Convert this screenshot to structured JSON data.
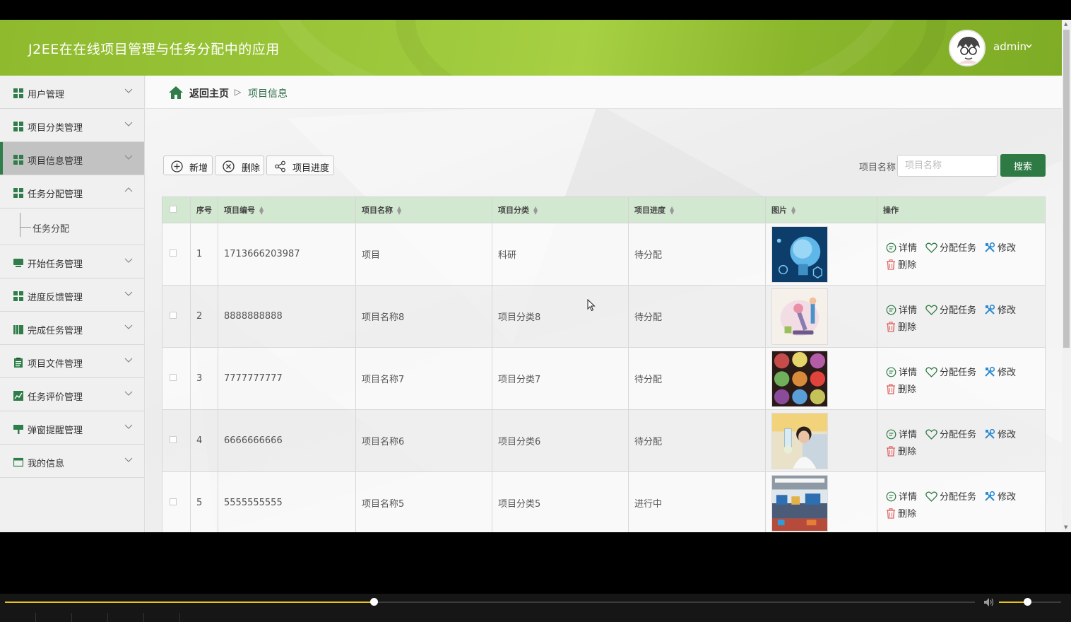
{
  "header": {
    "title": "J2EE在在线项目管理与任务分配中的应用",
    "user": "admin"
  },
  "sidebar": {
    "items": [
      {
        "label": "用户管理",
        "icon": "grid-icon",
        "expanded": false
      },
      {
        "label": "项目分类管理",
        "icon": "grid-icon",
        "expanded": false
      },
      {
        "label": "项目信息管理",
        "icon": "grid-icon",
        "expanded": false,
        "active": true
      },
      {
        "label": "任务分配管理",
        "icon": "grid-icon",
        "expanded": true
      },
      {
        "label": "开始任务管理",
        "icon": "monitor-icon",
        "expanded": false
      },
      {
        "label": "进度反馈管理",
        "icon": "grid-icon",
        "expanded": false
      },
      {
        "label": "完成任务管理",
        "icon": "books-icon",
        "expanded": false
      },
      {
        "label": "项目文件管理",
        "icon": "clipboard-icon",
        "expanded": false
      },
      {
        "label": "任务评价管理",
        "icon": "chart-icon",
        "expanded": false
      },
      {
        "label": "弹窗提醒管理",
        "icon": "sign-icon",
        "expanded": false
      },
      {
        "label": "我的信息",
        "icon": "card-icon",
        "expanded": false
      }
    ],
    "subitems": {
      "任务分配管理": [
        "任务分配"
      ]
    }
  },
  "breadcrumb": {
    "home": "返回主页",
    "separator": "▷",
    "current": "项目信息"
  },
  "toolbar": {
    "add_label": "新增",
    "delete_label": "删除",
    "progress_label": "项目进度"
  },
  "search": {
    "label": "项目名称",
    "placeholder": "项目名称",
    "button": "搜索"
  },
  "table": {
    "columns": [
      "序号",
      "项目编号",
      "项目名称",
      "项目分类",
      "项目进度",
      "图片",
      "操作"
    ],
    "rows": [
      {
        "index": "1",
        "code": "1713666203987",
        "name": "项目",
        "category": "科研",
        "progress": "待分配",
        "image": "ai-brain"
      },
      {
        "index": "2",
        "code": "8888888888",
        "name": "项目名称8",
        "category": "项目分类8",
        "progress": "待分配",
        "image": "microscope"
      },
      {
        "index": "3",
        "code": "7777777777",
        "name": "项目名称7",
        "category": "项目分类7",
        "progress": "待分配",
        "image": "petri-dishes"
      },
      {
        "index": "4",
        "code": "6666666666",
        "name": "项目名称6",
        "category": "项目分类6",
        "progress": "待分配",
        "image": "lab-researcher"
      },
      {
        "index": "5",
        "code": "5555555555",
        "name": "项目名称5",
        "category": "项目分类5",
        "progress": "进行中",
        "image": "laboratory"
      }
    ],
    "actions": {
      "detail": "详情",
      "assign": "分配任务",
      "edit": "修改",
      "delete": "删除"
    }
  },
  "player": {
    "seek_progress": 0.38,
    "volume": 0.45
  },
  "colors": {
    "header_green": "#9cc73a",
    "primary_green": "#2e7a45",
    "table_header": "#d3e8d1",
    "delete_red": "#e06060",
    "seek_yellow": "#e8c41a"
  }
}
